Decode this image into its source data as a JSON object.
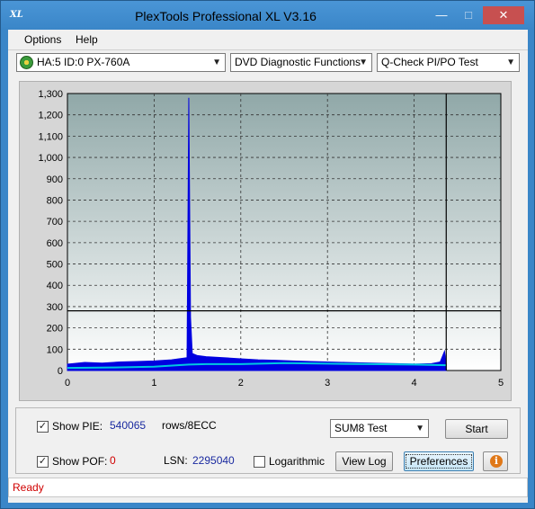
{
  "window": {
    "title": "PlexTools Professional XL V3.16",
    "app_icon_text": "XL"
  },
  "menu": [
    {
      "label": "Options",
      "accel": "O"
    },
    {
      "label": "Help",
      "accel": "H"
    }
  ],
  "toolbar": {
    "drive": "HA:5 ID:0  PX-760A",
    "function": "DVD Diagnostic Functions",
    "test": "Q-Check PI/PO Test"
  },
  "chart_data": {
    "type": "area",
    "xlim": [
      0,
      5
    ],
    "ylim": [
      0,
      1300
    ],
    "x_ticks": [
      "0",
      "1",
      "2",
      "3",
      "4",
      "5"
    ],
    "y_ticks": [
      "0",
      "100",
      "200",
      "300",
      "400",
      "500",
      "600",
      "700",
      "800",
      "900",
      "1,000",
      "1,100",
      "1,200",
      "1,300"
    ],
    "threshold": 280,
    "end_marker_x": 4.37,
    "grid": true,
    "colors": {
      "pie": "#0000e0",
      "sum": "#00c8e0",
      "plot_top": "#90a8a8",
      "plot_bottom": "#ffffff"
    },
    "series": [
      {
        "x": [
          0,
          0.2,
          0.4,
          0.6,
          0.8,
          1.0,
          1.2,
          1.38,
          1.4,
          1.42,
          1.44,
          1.5,
          1.6,
          1.8,
          2.0,
          2.2,
          2.4,
          2.6,
          2.8,
          3.0,
          3.2,
          3.4,
          3.6,
          3.8,
          4.0,
          4.2,
          4.3,
          4.35,
          4.37
        ],
        "y": [
          30,
          38,
          35,
          40,
          42,
          45,
          50,
          60,
          1280,
          250,
          80,
          70,
          65,
          60,
          55,
          50,
          48,
          45,
          42,
          40,
          38,
          36,
          34,
          32,
          30,
          32,
          40,
          90,
          30
        ]
      },
      {
        "x": [
          0,
          0.5,
          1.0,
          1.4,
          1.6,
          2.0,
          2.5,
          3.0,
          3.5,
          4.0,
          4.37
        ],
        "y": [
          12,
          14,
          18,
          28,
          30,
          30,
          35,
          32,
          30,
          28,
          25
        ]
      }
    ]
  },
  "controls": {
    "show_pie_label": "Show PIE:",
    "pie_value": "540065",
    "pie_unit": "rows/8ECC",
    "show_pof_label": "Show POF:",
    "pof_value": "0",
    "lsn_label": "LSN:",
    "lsn_value": "2295040",
    "logarithmic_label": "Logarithmic",
    "test_select": "SUM8 Test",
    "start_label": "Start",
    "view_log_label": "View Log",
    "preferences_label": "Preferences",
    "info_glyph": "i",
    "check_glyph": "✓"
  },
  "status": {
    "text": "Ready"
  }
}
